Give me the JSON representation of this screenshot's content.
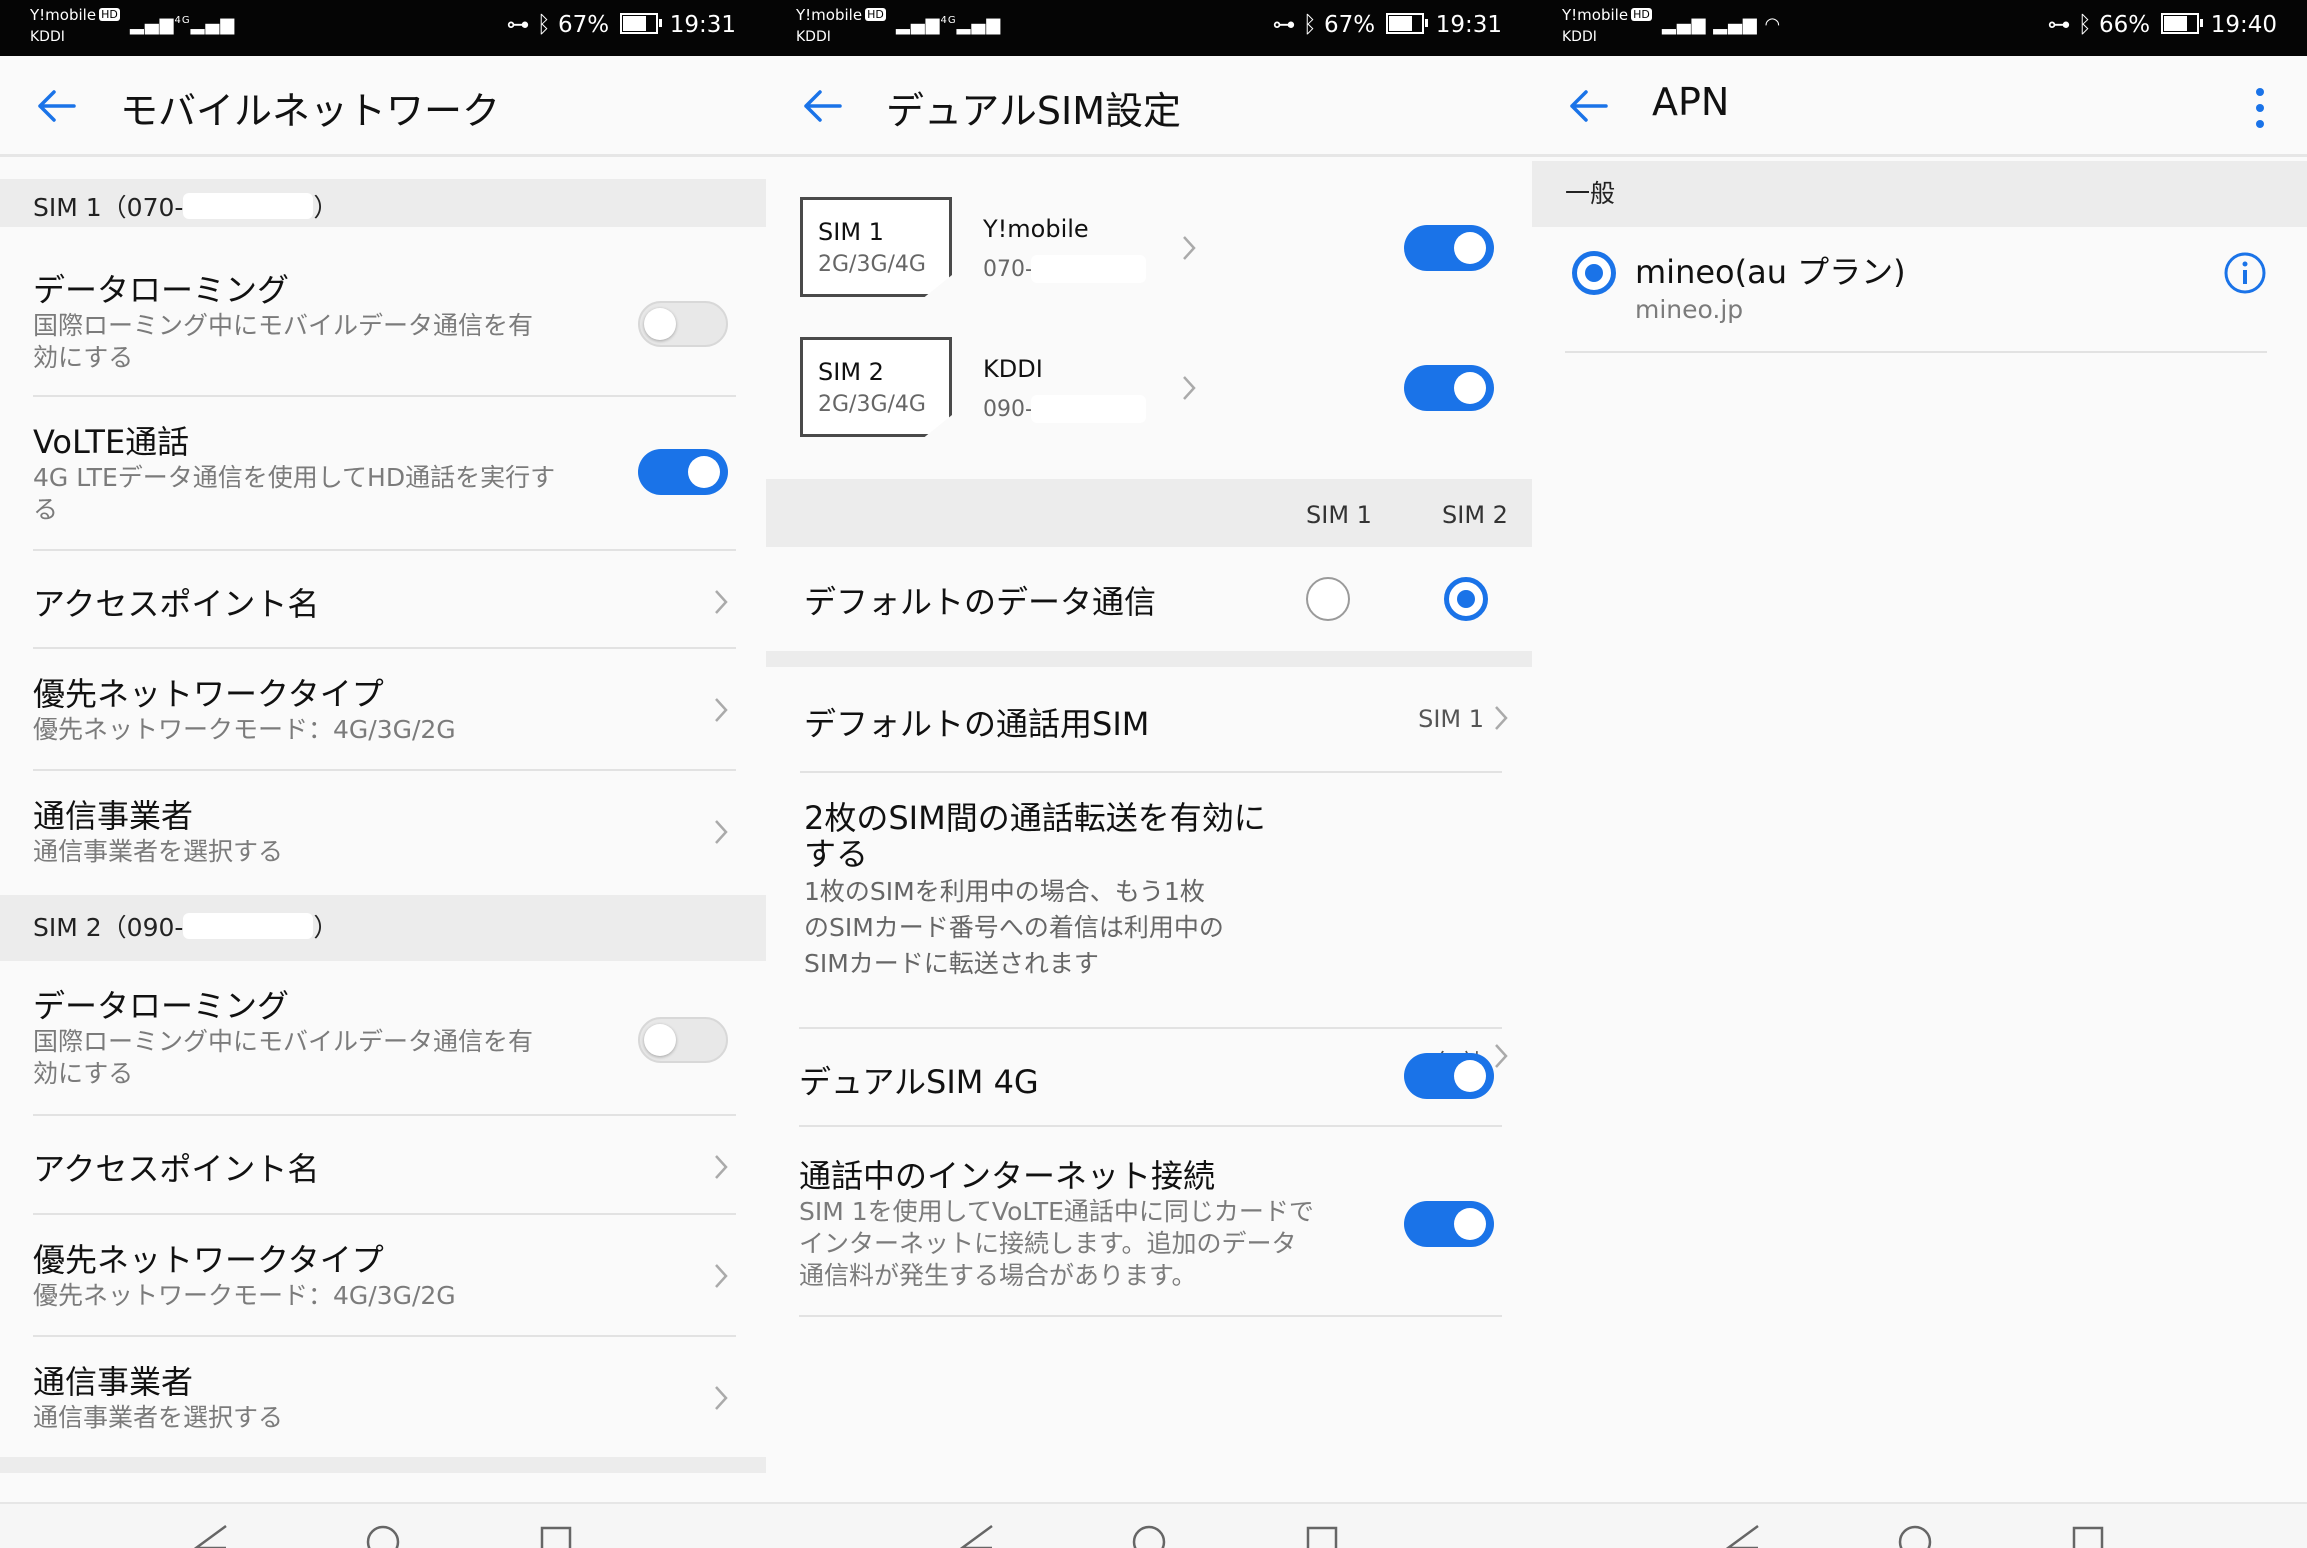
{
  "status_bars": [
    {
      "carrier1": "Y!mobile",
      "hd": "HD",
      "carrier2": "KDDI",
      "network": "4G",
      "battery": "67%",
      "battery_level": 0.67,
      "time": "19:31"
    },
    {
      "carrier1": "Y!mobile",
      "hd": "HD",
      "carrier2": "KDDI",
      "network": "4G",
      "battery": "67%",
      "battery_level": 0.67,
      "time": "19:31"
    },
    {
      "carrier1": "Y!mobile",
      "hd": "HD",
      "carrier2": "KDDI",
      "network": "",
      "battery": "66%",
      "battery_level": 0.66,
      "time": "19:40"
    }
  ],
  "screen1": {
    "title": "モバイルネットワーク",
    "sim1_header": "SIM 1（070-",
    "sim1_header_end": "）",
    "sim2_header": "SIM 2（090-",
    "sim2_header_end": "）",
    "sim1_items": [
      {
        "title": "データローミング",
        "sub1": "国際ローミング中にモバイルデータ通信を有",
        "sub2": "効にする",
        "toggle": false
      },
      {
        "title": "VoLTE通話",
        "sub1": "4G LTEデータ通信を使用してHD通話を実行す",
        "sub2": "る",
        "toggle": true
      },
      {
        "title": "アクセスポイント名"
      },
      {
        "title": "優先ネットワークタイプ",
        "sub1": "優先ネットワークモード：4G/3G/2G"
      },
      {
        "title": "通信事業者",
        "sub1": "通信事業者を選択する"
      }
    ],
    "sim2_items": [
      {
        "title": "データローミング",
        "sub1": "国際ローミング中にモバイルデータ通信を有",
        "sub2": "効にする",
        "toggle": false
      },
      {
        "title": "アクセスポイント名"
      },
      {
        "title": "優先ネットワークタイプ",
        "sub1": "優先ネットワークモード：4G/3G/2G"
      },
      {
        "title": "通信事業者",
        "sub1": "通信事業者を選択する"
      }
    ]
  },
  "screen2": {
    "title": "デュアルSIM設定",
    "sims": [
      {
        "card": "SIM 1",
        "bands": "2G/3G/4G",
        "carrier": "Y!mobile",
        "number": "070-",
        "enabled": true
      },
      {
        "card": "SIM 2",
        "bands": "2G/3G/4G",
        "carrier": "KDDI",
        "number": "090-",
        "enabled": true
      }
    ],
    "col_sim1": "SIM 1",
    "col_sim2": "SIM 2",
    "default_data": {
      "label": "デフォルトのデータ通信",
      "selected": "SIM 2"
    },
    "default_call": {
      "label": "デフォルトの通話用SIM",
      "value": "SIM 1"
    },
    "forward": {
      "title1": "2枚のSIM間の通話転送を有効に",
      "title2": "する",
      "sub1": "1枚のSIMを利用中の場合、もう1枚",
      "sub2": "のSIMカード番号への着信は利用中の",
      "sub3": "SIMカードに転送されます",
      "value": "無効"
    },
    "dual4g": {
      "label": "デュアルSIM 4G",
      "enabled": true
    },
    "internet": {
      "title": "通話中のインターネット接続",
      "sub1": "SIM 1を使用してVoLTE通話中に同じカードで",
      "sub2": "インターネットに接続します。追加のデータ",
      "sub3": "通信料が発生する場合があります。",
      "enabled": true
    }
  },
  "screen3": {
    "title": "APN",
    "section": "一般",
    "apn": {
      "name": "mineo(au プラン)",
      "apn": "mineo.jp",
      "selected": true
    }
  },
  "colors": {
    "accent": "#1a73e8",
    "status_bar": "#050505",
    "background": "#fafafa"
  }
}
